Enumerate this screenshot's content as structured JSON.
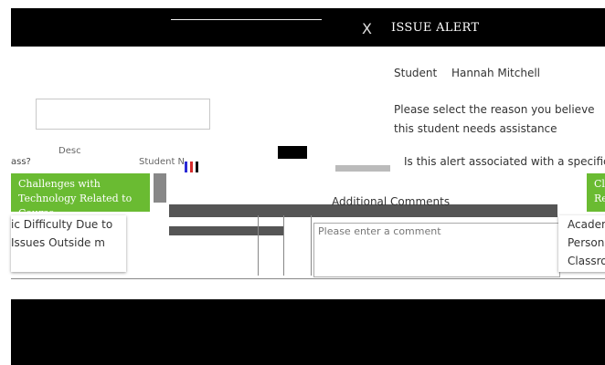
{
  "modal": {
    "title": "ISSUE ALERT",
    "close_symbol": "X"
  },
  "student": {
    "label": "Student",
    "name": "Hannah Mitchell"
  },
  "instructions": "Please select the reason you believe this student needs assistance",
  "question_specific": "Is this alert associated with a specific",
  "row_text": {
    "prefix": "ass?",
    "student_col": "Student N",
    "course_col": "Desc"
  },
  "reasons": {
    "tech_btn": "Challenges with Technology Related to Course",
    "tech_btn_right": "Cl Re",
    "left_card": "ic Difficulty Due to Issues Outside m",
    "right_card": "Academ Person Classro"
  },
  "comments": {
    "label": "Additional Comments",
    "placeholder": "Please enter a comment"
  },
  "colors": {
    "header_bg": "#000000",
    "reason_green": "#6abb32"
  }
}
